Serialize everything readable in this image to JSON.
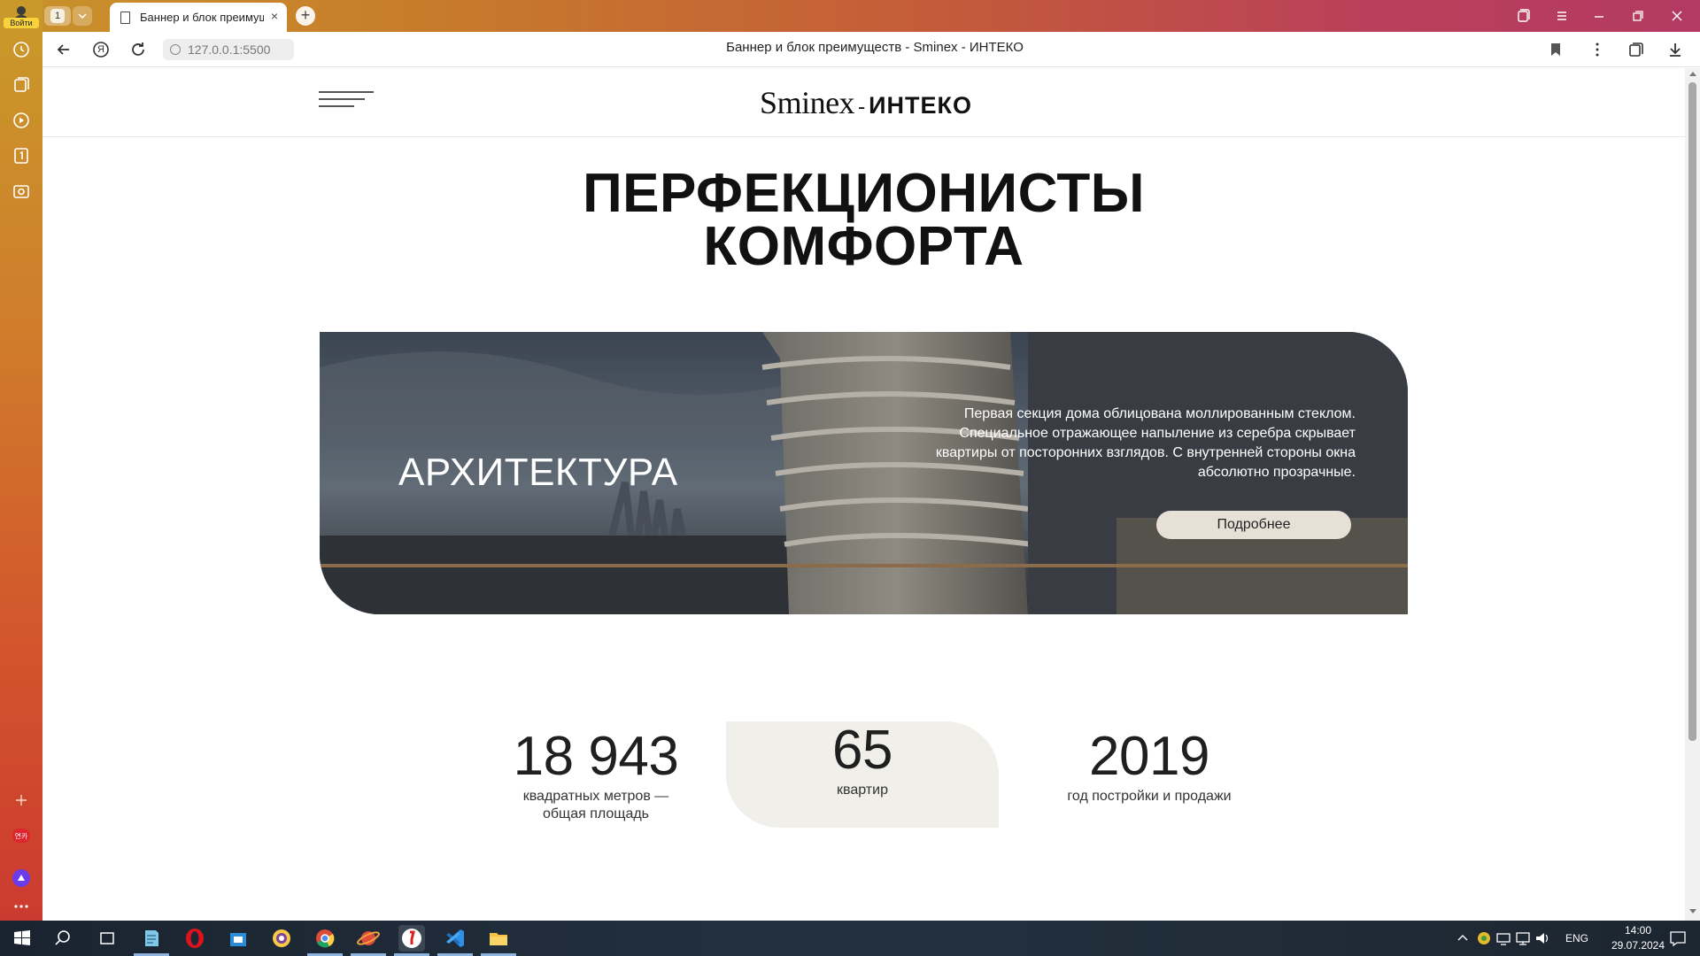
{
  "browser": {
    "login_label": "Войти",
    "tab_count": "1",
    "tab_title": "Баннер и блок преимущ",
    "tab_close": "×",
    "new_tab": "+",
    "url": "127.0.0.1:5500",
    "page_title": "Баннер и блок преимуществ - Sminex - ИНТЕКО",
    "yandex_glyph": "Я"
  },
  "site": {
    "logo": {
      "part1": "Sminex",
      "separator": "-",
      "part2": "ИНТЕКО"
    },
    "hero_title_line1": "ПЕРФЕКЦИОНИСТЫ",
    "hero_title_line2": "КОМФОРТА",
    "banner": {
      "title": "АРХИТЕКТУРА",
      "text": "Первая секция дома облицована моллированным стеклом. Специальное отражающее напыление из серебра скрывает квартиры от посторонних взглядов. С внутренней стороны окна абсолютно прозрачные.",
      "button": "Подробнее"
    },
    "stats": [
      {
        "value": "18 943",
        "caption_line1": "квадратных метров —",
        "caption_line2": "общая площадь"
      },
      {
        "value": "65",
        "caption_line1": "квартир",
        "caption_line2": ""
      },
      {
        "value": "2019",
        "caption_line1": "год постройки и продажи",
        "caption_line2": ""
      }
    ]
  },
  "taskbar": {
    "lang": "ENG",
    "time": "14:00",
    "date": "29.07.2024"
  },
  "colors": {
    "banner_button": "#e6e0d6",
    "stat_highlight": "#f0efe9",
    "text_dark": "#111111"
  }
}
